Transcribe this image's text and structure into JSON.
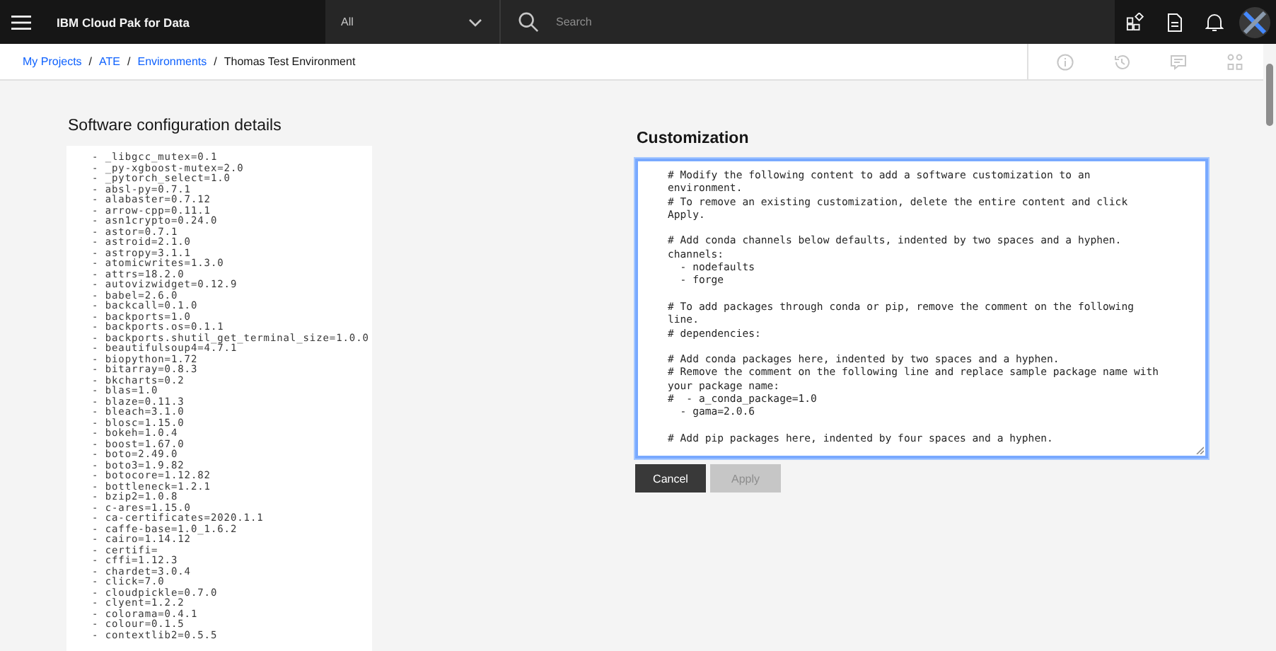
{
  "header": {
    "title": "IBM Cloud Pak for Data",
    "scope_dropdown": {
      "value": "All"
    },
    "search": {
      "placeholder": "Search"
    }
  },
  "breadcrumb": [
    {
      "label": "My Projects",
      "kind": "link"
    },
    {
      "label": "ATE",
      "kind": "link"
    },
    {
      "label": "Environments",
      "kind": "link"
    },
    {
      "label": "Thomas Test Environment",
      "kind": "current"
    }
  ],
  "breadcrumb_separator": "/",
  "software_config": {
    "title": "Software configuration details",
    "packages": [
      "- _libgcc_mutex=0.1",
      "- _py-xgboost-mutex=2.0",
      "- _pytorch_select=1.0",
      "- absl-py=0.7.1",
      "- alabaster=0.7.12",
      "- arrow-cpp=0.11.1",
      "- asn1crypto=0.24.0",
      "- astor=0.7.1",
      "- astroid=2.1.0",
      "- astropy=3.1.1",
      "- atomicwrites=1.3.0",
      "- attrs=18.2.0",
      "- autovizwidget=0.12.9",
      "- babel=2.6.0",
      "- backcall=0.1.0",
      "- backports=1.0",
      "- backports.os=0.1.1",
      "- backports.shutil_get_terminal_size=1.0.0",
      "- beautifulsoup4=4.7.1",
      "- biopython=1.72",
      "- bitarray=0.8.3",
      "- bkcharts=0.2",
      "- blas=1.0",
      "- blaze=0.11.3",
      "- bleach=3.1.0",
      "- blosc=1.15.0",
      "- bokeh=1.0.4",
      "- boost=1.67.0",
      "- boto=2.49.0",
      "- boto3=1.9.82",
      "- botocore=1.12.82",
      "- bottleneck=1.2.1",
      "- bzip2=1.0.8",
      "- c-ares=1.15.0",
      "- ca-certificates=2020.1.1",
      "- caffe-base=1.0_1.6.2",
      "- cairo=1.14.12",
      "- certifi=",
      "- cffi=1.12.3",
      "- chardet=3.0.4",
      "- click=7.0",
      "- cloudpickle=0.7.0",
      "- clyent=1.2.2",
      "- colorama=0.4.1",
      "- colour=0.1.5",
      "- contextlib2=0.5.5"
    ]
  },
  "customization": {
    "title": "Customization",
    "editor_blocks": [
      [
        "# Modify the following content to add a software customization to an",
        "environment.",
        "# To remove an existing customization, delete the entire content and click",
        "Apply."
      ],
      [
        "# Add conda channels below defaults, indented by two spaces and a hyphen.",
        "channels:",
        "  - nodefaults",
        "  - forge"
      ],
      [
        "# To add packages through conda or pip, remove the comment on the following",
        "line.",
        "# dependencies:"
      ],
      [
        "# Add conda packages here, indented by two spaces and a hyphen.",
        "# Remove the comment on the following line and replace sample package name with",
        "your package name:",
        "#  - a_conda_package=1.0",
        "  - gama=2.0.6"
      ],
      [
        "# Add pip packages here, indented by four spaces and a hyphen."
      ]
    ],
    "buttons": [
      {
        "label": "Cancel",
        "kind": "secondary",
        "disabled": false
      },
      {
        "label": "Apply",
        "kind": "primary",
        "disabled": true
      }
    ]
  }
}
